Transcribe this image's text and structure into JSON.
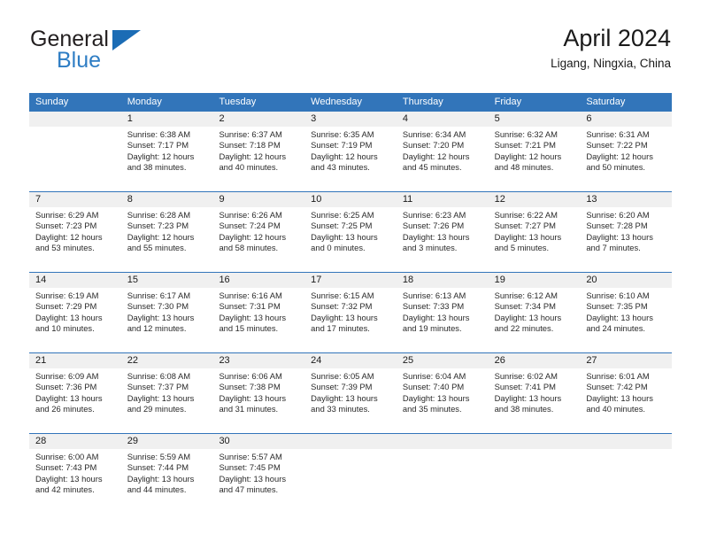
{
  "brand": {
    "name_part1": "General",
    "name_part2": "Blue",
    "triangle_color": "#1b6cb5",
    "blue_color": "#2e7dc4"
  },
  "header": {
    "title": "April 2024",
    "subtitle": "Ligang, Ningxia, China"
  },
  "theme": {
    "header_band": "#3275ba",
    "day_number_band": "#f0f0f0",
    "text": "#1a1a1a"
  },
  "weekdays": [
    "Sunday",
    "Monday",
    "Tuesday",
    "Wednesday",
    "Thursday",
    "Friday",
    "Saturday"
  ],
  "weeks": [
    {
      "days": [
        {
          "num": "",
          "l1": "",
          "l2": "",
          "l3": "",
          "l4": ""
        },
        {
          "num": "1",
          "l1": "Sunrise: 6:38 AM",
          "l2": "Sunset: 7:17 PM",
          "l3": "Daylight: 12 hours",
          "l4": "and 38 minutes."
        },
        {
          "num": "2",
          "l1": "Sunrise: 6:37 AM",
          "l2": "Sunset: 7:18 PM",
          "l3": "Daylight: 12 hours",
          "l4": "and 40 minutes."
        },
        {
          "num": "3",
          "l1": "Sunrise: 6:35 AM",
          "l2": "Sunset: 7:19 PM",
          "l3": "Daylight: 12 hours",
          "l4": "and 43 minutes."
        },
        {
          "num": "4",
          "l1": "Sunrise: 6:34 AM",
          "l2": "Sunset: 7:20 PM",
          "l3": "Daylight: 12 hours",
          "l4": "and 45 minutes."
        },
        {
          "num": "5",
          "l1": "Sunrise: 6:32 AM",
          "l2": "Sunset: 7:21 PM",
          "l3": "Daylight: 12 hours",
          "l4": "and 48 minutes."
        },
        {
          "num": "6",
          "l1": "Sunrise: 6:31 AM",
          "l2": "Sunset: 7:22 PM",
          "l3": "Daylight: 12 hours",
          "l4": "and 50 minutes."
        }
      ]
    },
    {
      "days": [
        {
          "num": "7",
          "l1": "Sunrise: 6:29 AM",
          "l2": "Sunset: 7:23 PM",
          "l3": "Daylight: 12 hours",
          "l4": "and 53 minutes."
        },
        {
          "num": "8",
          "l1": "Sunrise: 6:28 AM",
          "l2": "Sunset: 7:23 PM",
          "l3": "Daylight: 12 hours",
          "l4": "and 55 minutes."
        },
        {
          "num": "9",
          "l1": "Sunrise: 6:26 AM",
          "l2": "Sunset: 7:24 PM",
          "l3": "Daylight: 12 hours",
          "l4": "and 58 minutes."
        },
        {
          "num": "10",
          "l1": "Sunrise: 6:25 AM",
          "l2": "Sunset: 7:25 PM",
          "l3": "Daylight: 13 hours",
          "l4": "and 0 minutes."
        },
        {
          "num": "11",
          "l1": "Sunrise: 6:23 AM",
          "l2": "Sunset: 7:26 PM",
          "l3": "Daylight: 13 hours",
          "l4": "and 3 minutes."
        },
        {
          "num": "12",
          "l1": "Sunrise: 6:22 AM",
          "l2": "Sunset: 7:27 PM",
          "l3": "Daylight: 13 hours",
          "l4": "and 5 minutes."
        },
        {
          "num": "13",
          "l1": "Sunrise: 6:20 AM",
          "l2": "Sunset: 7:28 PM",
          "l3": "Daylight: 13 hours",
          "l4": "and 7 minutes."
        }
      ]
    },
    {
      "days": [
        {
          "num": "14",
          "l1": "Sunrise: 6:19 AM",
          "l2": "Sunset: 7:29 PM",
          "l3": "Daylight: 13 hours",
          "l4": "and 10 minutes."
        },
        {
          "num": "15",
          "l1": "Sunrise: 6:17 AM",
          "l2": "Sunset: 7:30 PM",
          "l3": "Daylight: 13 hours",
          "l4": "and 12 minutes."
        },
        {
          "num": "16",
          "l1": "Sunrise: 6:16 AM",
          "l2": "Sunset: 7:31 PM",
          "l3": "Daylight: 13 hours",
          "l4": "and 15 minutes."
        },
        {
          "num": "17",
          "l1": "Sunrise: 6:15 AM",
          "l2": "Sunset: 7:32 PM",
          "l3": "Daylight: 13 hours",
          "l4": "and 17 minutes."
        },
        {
          "num": "18",
          "l1": "Sunrise: 6:13 AM",
          "l2": "Sunset: 7:33 PM",
          "l3": "Daylight: 13 hours",
          "l4": "and 19 minutes."
        },
        {
          "num": "19",
          "l1": "Sunrise: 6:12 AM",
          "l2": "Sunset: 7:34 PM",
          "l3": "Daylight: 13 hours",
          "l4": "and 22 minutes."
        },
        {
          "num": "20",
          "l1": "Sunrise: 6:10 AM",
          "l2": "Sunset: 7:35 PM",
          "l3": "Daylight: 13 hours",
          "l4": "and 24 minutes."
        }
      ]
    },
    {
      "days": [
        {
          "num": "21",
          "l1": "Sunrise: 6:09 AM",
          "l2": "Sunset: 7:36 PM",
          "l3": "Daylight: 13 hours",
          "l4": "and 26 minutes."
        },
        {
          "num": "22",
          "l1": "Sunrise: 6:08 AM",
          "l2": "Sunset: 7:37 PM",
          "l3": "Daylight: 13 hours",
          "l4": "and 29 minutes."
        },
        {
          "num": "23",
          "l1": "Sunrise: 6:06 AM",
          "l2": "Sunset: 7:38 PM",
          "l3": "Daylight: 13 hours",
          "l4": "and 31 minutes."
        },
        {
          "num": "24",
          "l1": "Sunrise: 6:05 AM",
          "l2": "Sunset: 7:39 PM",
          "l3": "Daylight: 13 hours",
          "l4": "and 33 minutes."
        },
        {
          "num": "25",
          "l1": "Sunrise: 6:04 AM",
          "l2": "Sunset: 7:40 PM",
          "l3": "Daylight: 13 hours",
          "l4": "and 35 minutes."
        },
        {
          "num": "26",
          "l1": "Sunrise: 6:02 AM",
          "l2": "Sunset: 7:41 PM",
          "l3": "Daylight: 13 hours",
          "l4": "and 38 minutes."
        },
        {
          "num": "27",
          "l1": "Sunrise: 6:01 AM",
          "l2": "Sunset: 7:42 PM",
          "l3": "Daylight: 13 hours",
          "l4": "and 40 minutes."
        }
      ]
    },
    {
      "days": [
        {
          "num": "28",
          "l1": "Sunrise: 6:00 AM",
          "l2": "Sunset: 7:43 PM",
          "l3": "Daylight: 13 hours",
          "l4": "and 42 minutes."
        },
        {
          "num": "29",
          "l1": "Sunrise: 5:59 AM",
          "l2": "Sunset: 7:44 PM",
          "l3": "Daylight: 13 hours",
          "l4": "and 44 minutes."
        },
        {
          "num": "30",
          "l1": "Sunrise: 5:57 AM",
          "l2": "Sunset: 7:45 PM",
          "l3": "Daylight: 13 hours",
          "l4": "and 47 minutes."
        },
        {
          "num": "",
          "l1": "",
          "l2": "",
          "l3": "",
          "l4": ""
        },
        {
          "num": "",
          "l1": "",
          "l2": "",
          "l3": "",
          "l4": ""
        },
        {
          "num": "",
          "l1": "",
          "l2": "",
          "l3": "",
          "l4": ""
        },
        {
          "num": "",
          "l1": "",
          "l2": "",
          "l3": "",
          "l4": ""
        }
      ]
    }
  ]
}
